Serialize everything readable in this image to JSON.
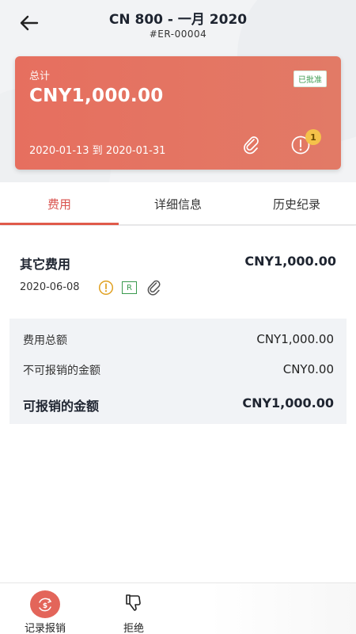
{
  "header": {
    "title": "CN 800 - 一月 2020",
    "report_id": "#ER-00004"
  },
  "summary_card": {
    "total_label": "总计",
    "total_amount": "CNY1,000.00",
    "status_badge": "已批准",
    "date_range": "2020-01-13 到 2020-01-31",
    "alert_count": "1",
    "card_color": "#e66f5f"
  },
  "tabs": [
    {
      "label": "费用",
      "active": true
    },
    {
      "label": "详细信息",
      "active": false
    },
    {
      "label": "历史纪录",
      "active": false
    }
  ],
  "expense": {
    "name": "其它费用",
    "amount": "CNY1,000.00",
    "date": "2020-06-08",
    "receipt_badge": "R",
    "icons": [
      "warning-icon",
      "attachment-icon"
    ]
  },
  "totals": {
    "rows": [
      {
        "label": "费用总额",
        "value": "CNY1,000.00"
      },
      {
        "label": "不可报销的金额",
        "value": "CNY0.00"
      },
      {
        "label": "可报销的金额",
        "value": "CNY1,000.00"
      }
    ]
  },
  "bottom_nav": {
    "record_label": "记录报销",
    "reject_label": "拒绝",
    "accent": "#e3655a"
  }
}
